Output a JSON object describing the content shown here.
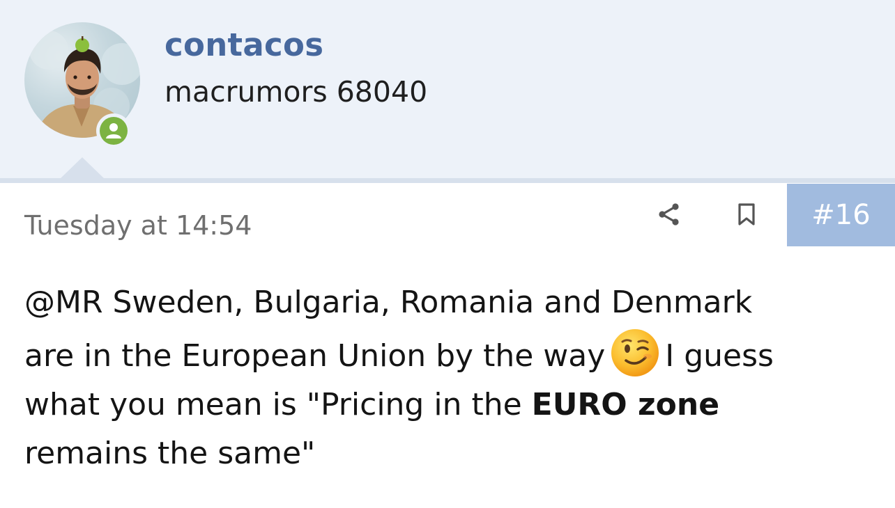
{
  "user": {
    "username": "contacos",
    "title": "macrumors 68040"
  },
  "post": {
    "date": "Tuesday at 14:54",
    "number": "#16",
    "message": {
      "mention": "@MR",
      "line1_rest": " Sweden, Bulgaria, Romania and Denmark",
      "line2_a": "are in the European Union by the way",
      "line2_b": "I guess",
      "line3_a": "what you mean is \"Pricing in the ",
      "line3_bold": "EURO zone",
      "line4": "remains the same\""
    }
  },
  "icons": {
    "share": "share-icon",
    "bookmark": "bookmark-icon",
    "online": "online-user-icon",
    "emoji": "winking-face-emoji"
  },
  "colors": {
    "header_bg": "#edf2f9",
    "header_border": "#d7e0ec",
    "username": "#47689d",
    "post_number_bg": "#a1bbdf",
    "online": "#7cb342"
  }
}
